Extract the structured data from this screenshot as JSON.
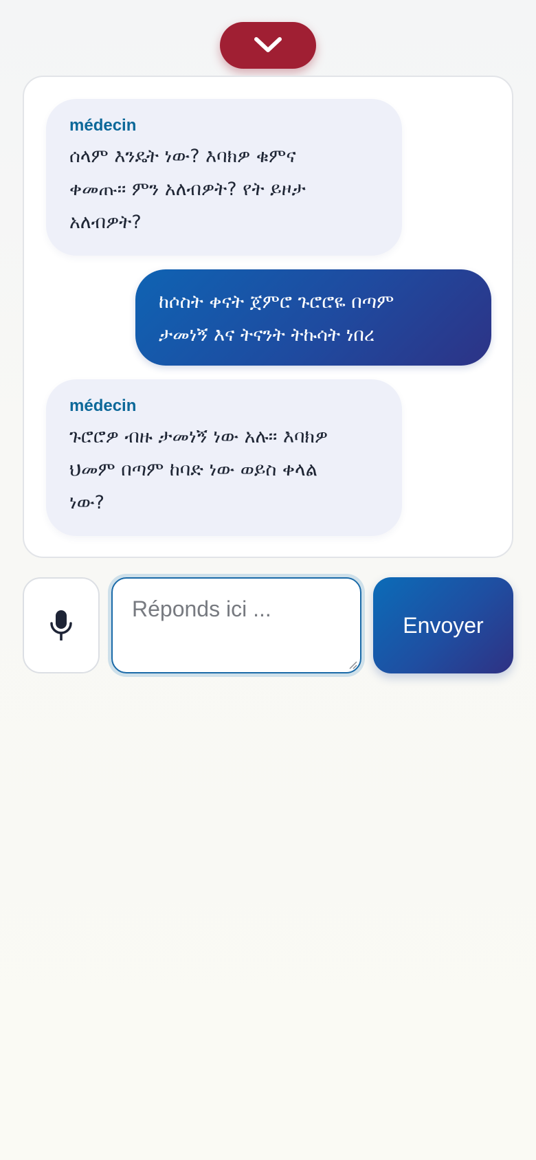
{
  "header": {
    "collapse_icon": "chevron-down-icon"
  },
  "colors": {
    "accent_red": "#a01f33",
    "accent_blue": "#0b6cb8",
    "sender_label": "#0c6899"
  },
  "messages": [
    {
      "role": "doctor",
      "sender": "médecin",
      "lines": [
        "ሰላም እንዴት ነው? እባክዎ ቁምና",
        "ቀመጡ። ምን አለብዎት? የት ይዞታ",
        "አለብዎት?"
      ]
    },
    {
      "role": "patient",
      "lines": [
        "ከሶስት ቀናት ጀምሮ ጉሮሮዬ በጣም",
        "ታመነኝ እና ትናንት ትኩሳት ነበረ"
      ]
    },
    {
      "role": "doctor",
      "sender": "médecin",
      "lines": [
        "ጉሮሮዎ ብዙ ታመነኝ ነው አሉ። እባክዎ",
        "ህመም በጣም ከባድ ነው ወይስ ቀላል",
        "ነው?"
      ]
    }
  ],
  "composer": {
    "mic_icon": "microphone-icon",
    "placeholder": "Réponds ici ...",
    "send_label": "Envoyer"
  }
}
